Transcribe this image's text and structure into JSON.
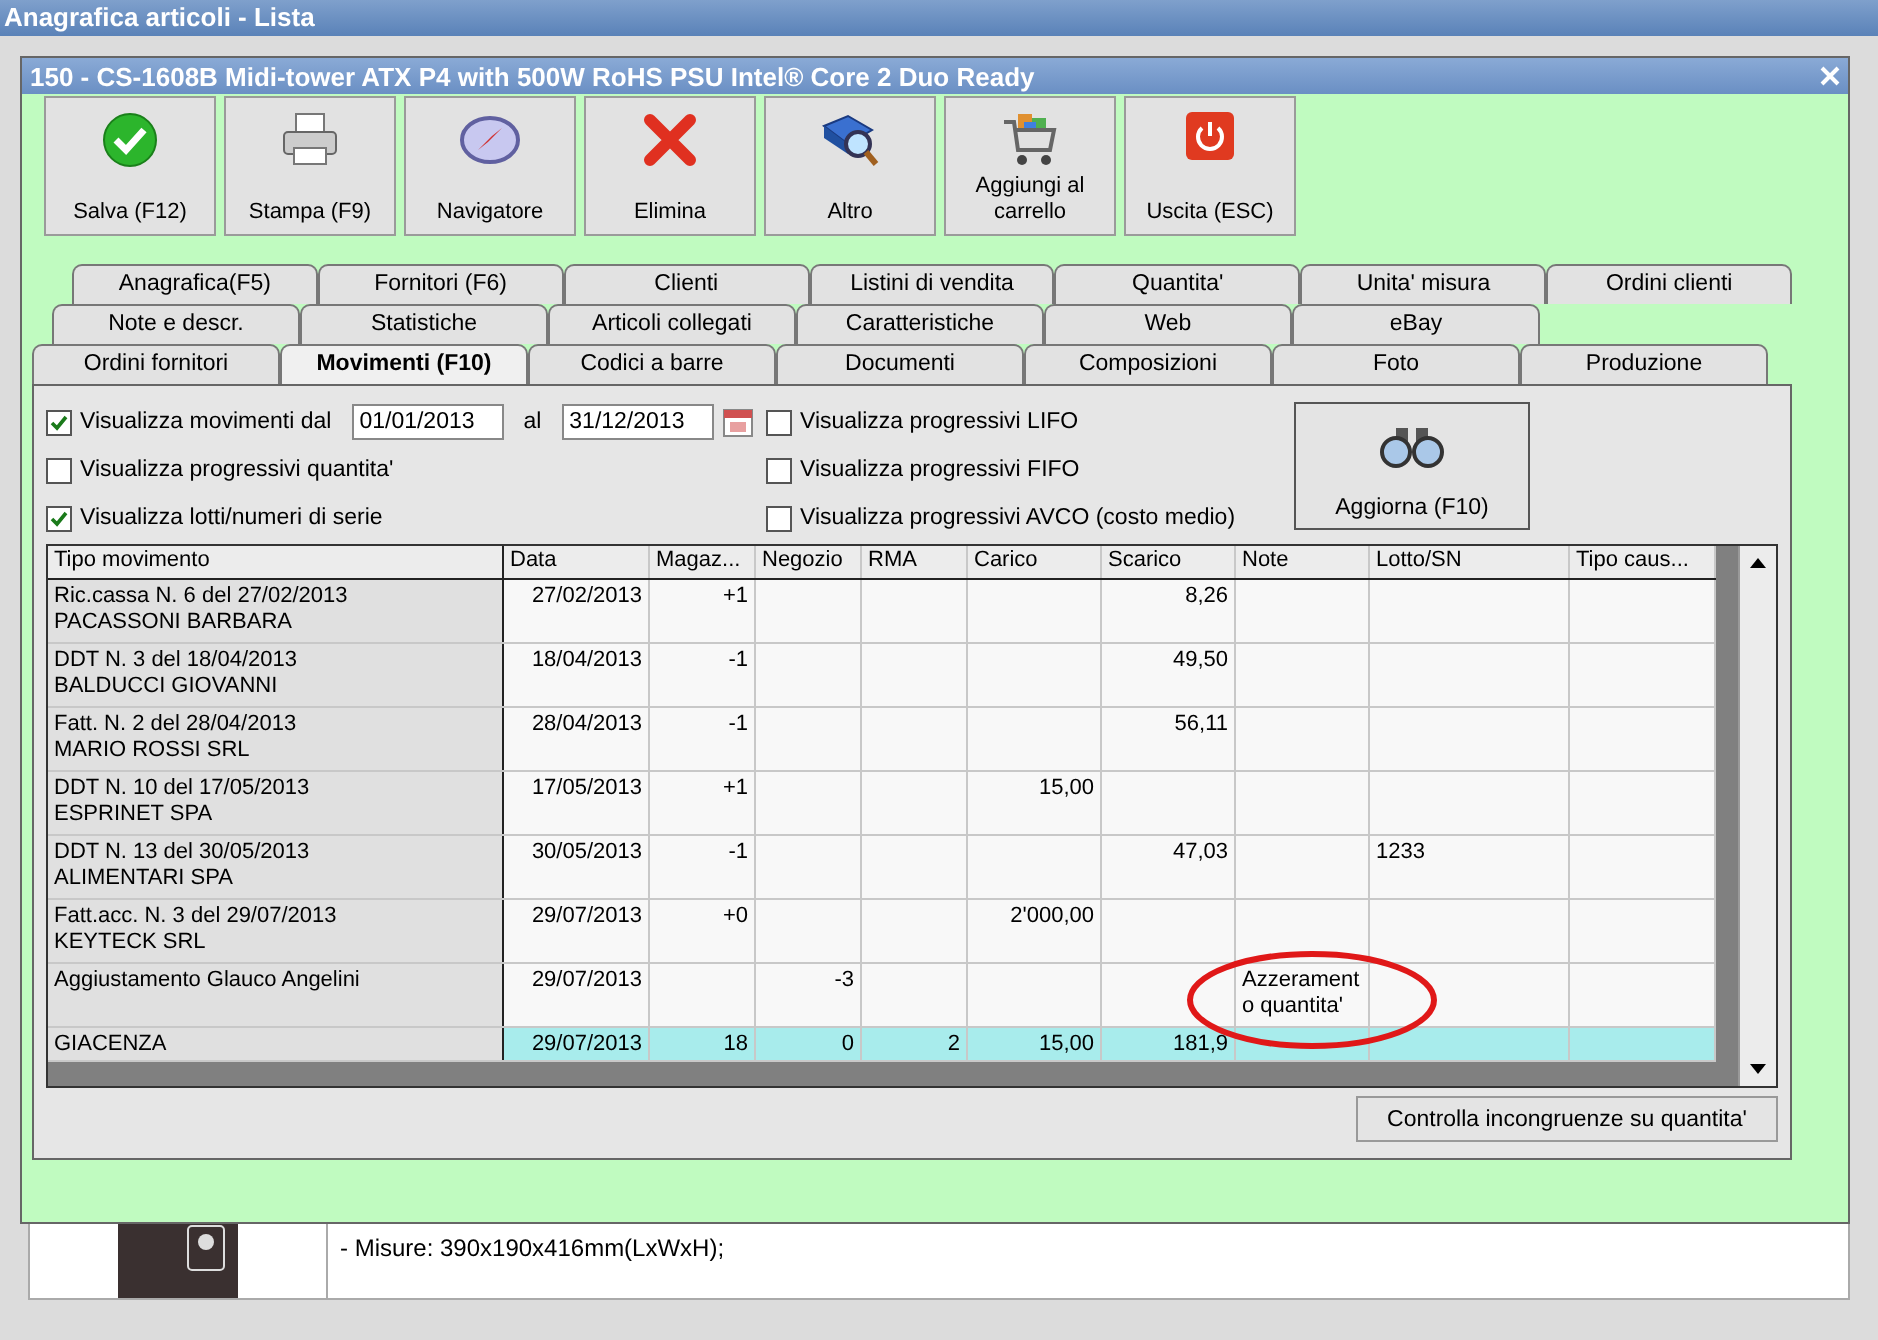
{
  "window": {
    "title": "Anagrafica articoli  - Lista"
  },
  "dialog": {
    "title": "150 - CS-1608B Midi-tower ATX P4 with 500W RoHS PSU Intel® Core 2 Duo Ready"
  },
  "toolbar": [
    {
      "kind": "save",
      "label": "Salva (F12)"
    },
    {
      "kind": "print",
      "label": "Stampa (F9)"
    },
    {
      "kind": "navigator",
      "label": "Navigatore"
    },
    {
      "kind": "delete",
      "label": "Elimina"
    },
    {
      "kind": "more",
      "label": "Altro"
    },
    {
      "kind": "cart",
      "label": "Aggiungi al carrello"
    },
    {
      "kind": "exit",
      "label": "Uscita (ESC)"
    }
  ],
  "tab_rows": [
    {
      "tabs": [
        {
          "label": "Anagrafica(F5)",
          "selected": false
        },
        {
          "label": "Fornitori (F6)",
          "selected": false
        },
        {
          "label": "Clienti",
          "selected": false
        },
        {
          "label": "Listini di vendita",
          "selected": false
        },
        {
          "label": "Quantita'",
          "selected": false
        },
        {
          "label": "Unita' misura",
          "selected": false
        },
        {
          "label": "Ordini clienti",
          "selected": false
        }
      ]
    },
    {
      "tabs": [
        {
          "label": "Note e descr.",
          "selected": false
        },
        {
          "label": "Statistiche",
          "selected": false
        },
        {
          "label": "Articoli collegati",
          "selected": false
        },
        {
          "label": "Caratteristiche",
          "selected": false
        },
        {
          "label": "Web",
          "selected": false
        },
        {
          "label": "eBay",
          "selected": false
        }
      ]
    },
    {
      "tabs": [
        {
          "label": "Ordini fornitori",
          "selected": false
        },
        {
          "label": "Movimenti (F10)",
          "selected": true
        },
        {
          "label": "Codici a barre",
          "selected": false
        },
        {
          "label": "Documenti",
          "selected": false
        },
        {
          "label": "Composizioni",
          "selected": false
        },
        {
          "label": "Foto",
          "selected": false
        },
        {
          "label": "Produzione",
          "selected": false
        }
      ]
    }
  ],
  "filters": {
    "period": {
      "label": "Visualizza movimenti dal",
      "checked": true,
      "from": "01/01/2013",
      "to_label": "al",
      "to": "31/12/2013"
    },
    "left_options": [
      {
        "label": "Visualizza progressivi quantita'",
        "checked": false
      },
      {
        "label": "Visualizza lotti/numeri di serie",
        "checked": true
      }
    ],
    "right_options": [
      {
        "label": "Visualizza progressivi LIFO",
        "checked": false
      },
      {
        "label": "Visualizza progressivi FIFO",
        "checked": false
      },
      {
        "label": "Visualizza progressivi AVCO (costo medio)",
        "checked": false
      }
    ]
  },
  "refresh_button": {
    "label": "Aggiorna (F10)"
  },
  "grid": {
    "columns": [
      "Tipo movimento",
      "Data",
      "Magaz...",
      "Negozio",
      "RMA",
      "Carico",
      "Scarico",
      "Note",
      "Lotto/SN",
      "Tipo caus..."
    ],
    "rows": [
      {
        "kind": "movement",
        "cells": [
          "Ric.cassa N. 6 del 27/02/2013\nPACASSONI BARBARA",
          "27/02/2013",
          "+1",
          null,
          null,
          null,
          "8,26",
          null,
          null,
          null
        ]
      },
      {
        "kind": "movement",
        "cells": [
          "DDT N. 3 del 18/04/2013\nBALDUCCI GIOVANNI",
          "18/04/2013",
          "-1",
          null,
          null,
          null,
          "49,50",
          null,
          null,
          null
        ]
      },
      {
        "kind": "movement",
        "cells": [
          "Fatt. N. 2 del 28/04/2013\nMARIO ROSSI SRL",
          "28/04/2013",
          "-1",
          null,
          null,
          null,
          "56,11",
          null,
          null,
          null
        ]
      },
      {
        "kind": "movement",
        "cells": [
          "DDT N. 10 del 17/05/2013\nESPRINET SPA",
          "17/05/2013",
          "+1",
          null,
          null,
          "15,00",
          null,
          null,
          null,
          null
        ]
      },
      {
        "kind": "movement",
        "cells": [
          "DDT N. 13 del 30/05/2013\nALIMENTARI SPA",
          "30/05/2013",
          "-1",
          null,
          null,
          null,
          "47,03",
          null,
          "1233",
          null
        ]
      },
      {
        "kind": "movement",
        "cells": [
          "Fatt.acc. N. 3 del 29/07/2013\nKEYTECK SRL",
          "29/07/2013",
          "+0",
          null,
          null,
          "2'000,00",
          null,
          null,
          null,
          null
        ]
      },
      {
        "kind": "movement",
        "cells": [
          "Aggiustamento Glauco Angelini",
          "29/07/2013",
          null,
          "-3",
          null,
          null,
          null,
          "Azzerament\no quantita'",
          null,
          null
        ]
      },
      {
        "kind": "total",
        "cells": [
          "GIACENZA",
          "29/07/2013",
          "18",
          "0",
          "2",
          "15,00",
          "181,9",
          null,
          null,
          null
        ]
      }
    ]
  },
  "check_button": {
    "label": "Controlla incongruenze su quantita'"
  },
  "description": {
    "lines": [
      "- Misure: 390x190x416mm(LxWxH);"
    ]
  }
}
